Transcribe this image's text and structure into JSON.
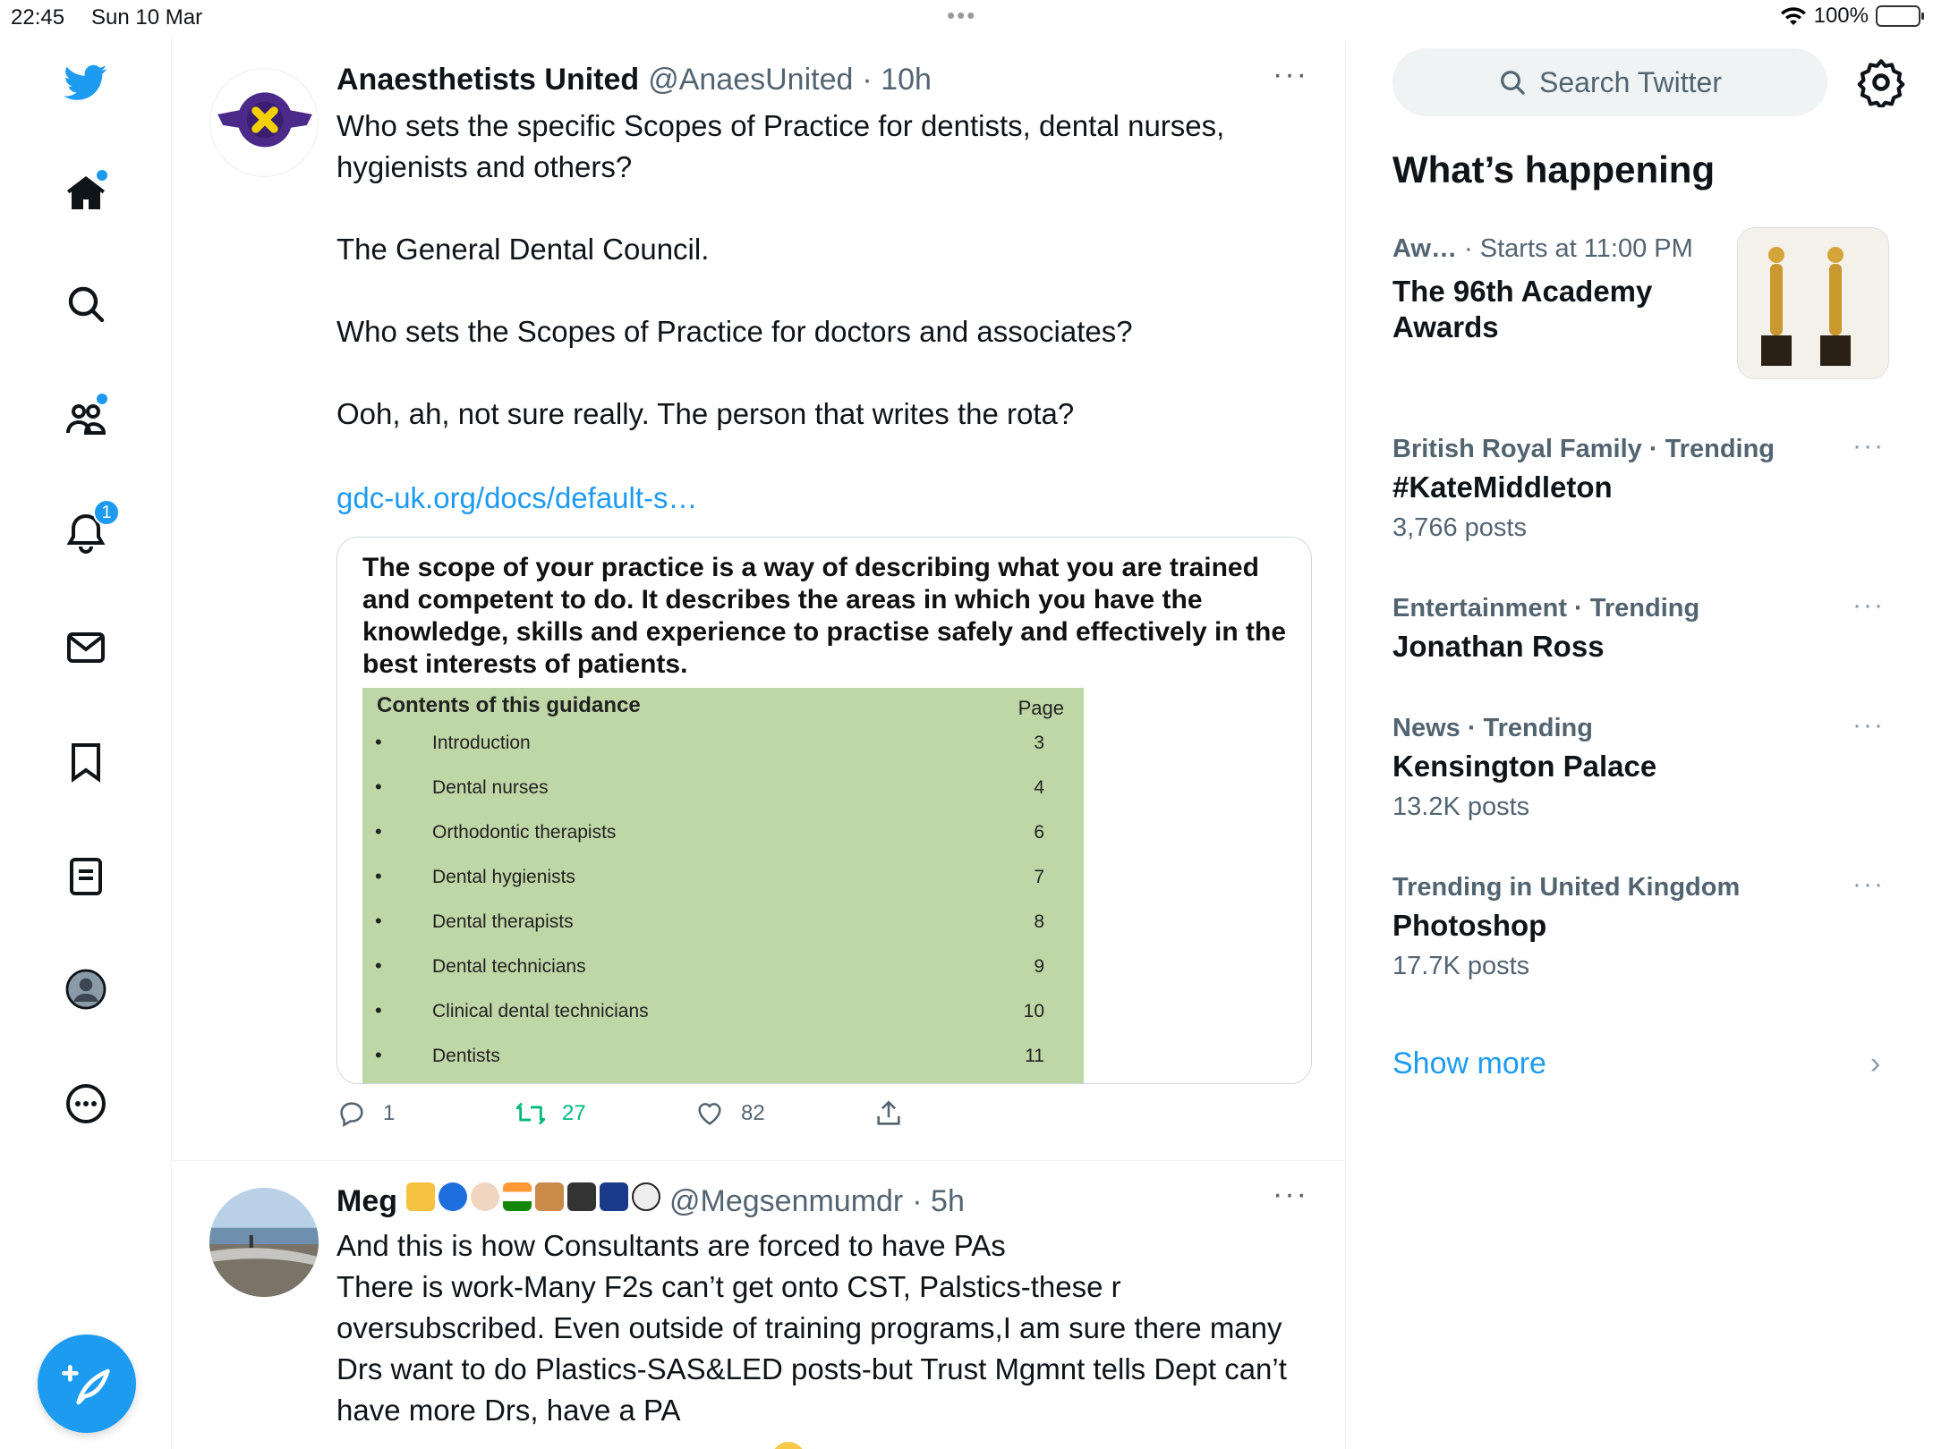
{
  "status_bar": {
    "time": "22:45",
    "date": "Sun 10 Mar",
    "battery": "100%"
  },
  "nav": {
    "notifications_badge": "1"
  },
  "timeline": {
    "tweets": [
      {
        "name": "Anaesthetists United",
        "handle": "@AnaesUnited",
        "time": "· 10h",
        "text": "Who sets the specific Scopes of Practice for dentists, dental nurses, hygienists and others?\n\nThe General Dental Council.\n\nWho sets the Scopes of Practice for doctors and associates?\n\nOoh, ah, not sure really. The person that writes the rota?",
        "link": "gdc-uk.org/docs/default-s…",
        "card": {
          "heading": "The scope of your practice is a way of describing what you are trained and competent to do. It describes the areas in which you have the knowledge, skills and experience to practise safely and effectively in the best interests of patients.",
          "contents_title": "Contents of this guidance",
          "page_header": "Page",
          "rows": [
            {
              "bullet": "•",
              "label": "Introduction",
              "page": "3"
            },
            {
              "bullet": "•",
              "label": "Dental nurses",
              "page": "4"
            },
            {
              "bullet": "•",
              "label": "Orthodontic therapists",
              "page": "6"
            },
            {
              "bullet": "•",
              "label": "Dental hygienists",
              "page": "7"
            },
            {
              "bullet": "•",
              "label": "Dental therapists",
              "page": "8"
            },
            {
              "bullet": "•",
              "label": "Dental technicians",
              "page": "9"
            },
            {
              "bullet": "•",
              "label": "Clinical dental technicians",
              "page": "10"
            },
            {
              "bullet": "•",
              "label": "Dentists",
              "page": "11"
            }
          ]
        },
        "replies": "1",
        "retweets": "27",
        "likes": "82"
      },
      {
        "name": "Meg",
        "handle": "@Megsenmumdr",
        "time": "· 5h",
        "text": "And this is how Consultants are forced to have PAs\nThere is work-Many F2s can’t get onto CST, Palstics-these r oversubscribed. Even outside of training programs,I am sure there many Drs want to do Plastics-SAS&LED posts-but Trust Mgmnt tells Dept can’t have more Drs, have a PA"
      }
    ]
  },
  "sidebar": {
    "search_placeholder": "Search Twitter",
    "whats_happening": "What’s happening",
    "event": {
      "category": "Aw…",
      "starts": "· Starts at 11:00 PM",
      "title": "The 96th Academy Awards"
    },
    "trends": [
      {
        "category": "British Royal Family · Trending",
        "name": "#KateMiddleton",
        "posts": "3,766 posts"
      },
      {
        "category": "Entertainment · Trending",
        "name": "Jonathan Ross",
        "posts": ""
      },
      {
        "category": "News · Trending",
        "name": "Kensington Palace",
        "posts": "13.2K posts"
      },
      {
        "category": "Trending in United Kingdom",
        "name": "Photoshop",
        "posts": "17.7K posts"
      }
    ],
    "show_more": "Show more"
  },
  "colors": {
    "accent": "#1d9bf0",
    "retweet": "#00ba7c",
    "secondary_text": "#536471"
  },
  "icons": [
    "twitter-logo-icon",
    "home-icon",
    "search-icon",
    "communities-icon",
    "bell-icon",
    "mail-icon",
    "bookmark-icon",
    "lists-icon",
    "profile-icon",
    "more-icon",
    "compose-icon",
    "reply-icon",
    "retweet-icon",
    "like-icon",
    "share-icon",
    "gear-icon"
  ]
}
